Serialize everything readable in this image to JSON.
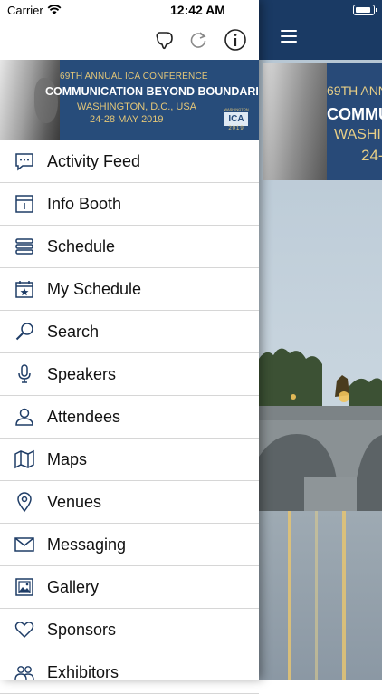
{
  "status_bar": {
    "carrier": "Carrier",
    "time": "12:42 AM"
  },
  "toolbar": {
    "icons": [
      "megaphone-icon",
      "refresh-icon",
      "info-icon"
    ]
  },
  "banner": {
    "line1": "69TH ANNUAL ICA CONFERENCE",
    "line2": "COMMUNICATION BEYOND BOUNDARIES",
    "line3": "WASHINGTON, D.C., USA",
    "line4": "24-28 MAY 2019",
    "logo_top": "WASHINGTON",
    "logo_mid": "ICA",
    "logo_year": "2019"
  },
  "main_screen": {
    "thumb_line1": "69TH ANN",
    "thumb_line2": "COMMUN",
    "thumb_line3": "WASHIN",
    "thumb_line4": "24-"
  },
  "menu": {
    "items": [
      {
        "label": "Activity Feed",
        "icon": "chat-icon"
      },
      {
        "label": "Info Booth",
        "icon": "booth-icon"
      },
      {
        "label": "Schedule",
        "icon": "list-icon"
      },
      {
        "label": "My Schedule",
        "icon": "calendar-star-icon"
      },
      {
        "label": "Search",
        "icon": "search-icon"
      },
      {
        "label": "Speakers",
        "icon": "microphone-icon"
      },
      {
        "label": "Attendees",
        "icon": "person-icon"
      },
      {
        "label": "Maps",
        "icon": "map-icon"
      },
      {
        "label": "Venues",
        "icon": "location-pin-icon"
      },
      {
        "label": "Messaging",
        "icon": "mail-icon"
      },
      {
        "label": "Gallery",
        "icon": "gallery-icon"
      },
      {
        "label": "Sponsors",
        "icon": "heart-icon"
      },
      {
        "label": "Exhibitors",
        "icon": "group-icon"
      }
    ]
  },
  "colors": {
    "icon_blue": "#1f3d67",
    "header_navy": "#1a3a64",
    "banner_blue": "#274c7a",
    "banner_gold": "#e3c678"
  }
}
